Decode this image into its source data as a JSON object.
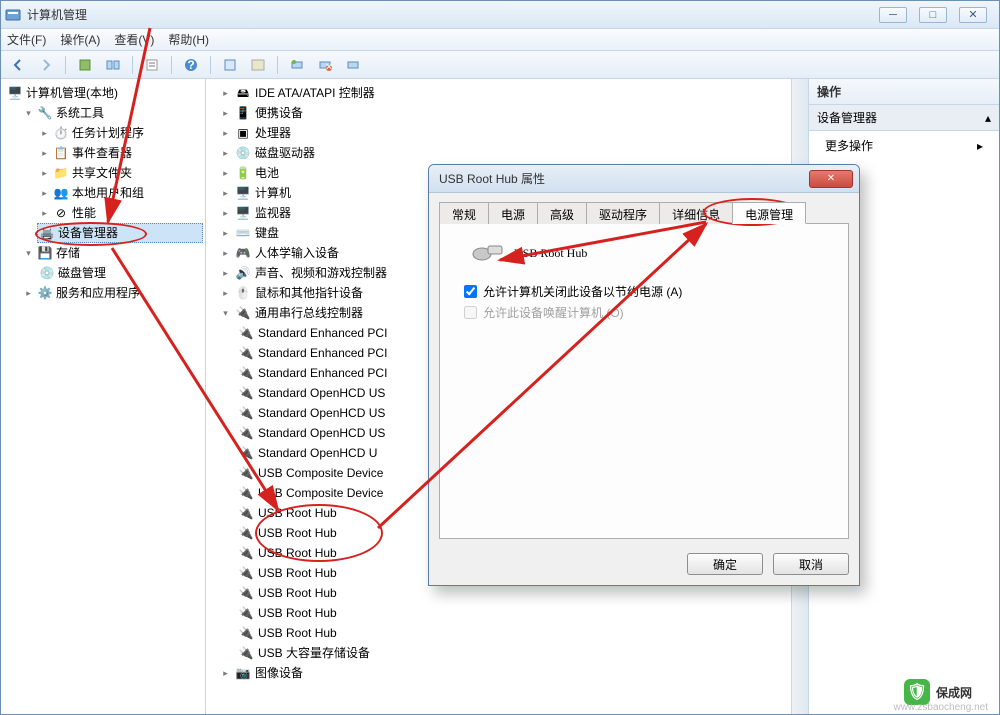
{
  "window": {
    "title": "计算机管理",
    "menus": [
      "文件(F)",
      "操作(A)",
      "查看(V)",
      "帮助(H)"
    ]
  },
  "left_tree": {
    "root": "计算机管理(本地)",
    "system_tools": "系统工具",
    "task_scheduler": "任务计划程序",
    "event_viewer": "事件查看器",
    "shared_folders": "共享文件夹",
    "local_users": "本地用户和组",
    "performance": "性能",
    "device_manager": "设备管理器",
    "storage": "存储",
    "disk_mgmt": "磁盘管理",
    "services": "服务和应用程序"
  },
  "right_panel": {
    "header": "操作",
    "context": "设备管理器",
    "more_actions": "更多操作"
  },
  "devices": {
    "ide": "IDE ATA/ATAPI 控制器",
    "portable": "便携设备",
    "cpu": "处理器",
    "disk_drives": "磁盘驱动器",
    "battery": "电池",
    "computer": "计算机",
    "monitor": "监视器",
    "keyboard": "键盘",
    "hid": "人体学输入设备",
    "sound": "声音、视频和游戏控制器",
    "mouse": "鼠标和其他指针设备",
    "usb_ctrl": "通用串行总线控制器",
    "usb_children": [
      "Standard Enhanced PCI",
      "Standard Enhanced PCI",
      "Standard Enhanced PCI",
      "Standard OpenHCD US",
      "Standard OpenHCD US",
      "Standard OpenHCD US",
      "Standard OpenHCD U",
      "USB Composite Device",
      "USB Composite Device",
      "USB Root Hub",
      "USB Root Hub",
      "USB Root Hub",
      "USB Root Hub",
      "USB Root Hub",
      "USB Root Hub",
      "USB Root Hub",
      "USB 大容量存储设备"
    ],
    "imaging": "图像设备"
  },
  "dialog": {
    "title": "USB Root Hub 属性",
    "tabs": [
      "常规",
      "电源",
      "高级",
      "驱动程序",
      "详细信息",
      "电源管理"
    ],
    "active_tab": "电源管理",
    "device_name": "USB Root Hub",
    "opt1": "允许计算机关闭此设备以节约电源 (A)",
    "opt2": "允许此设备唤醒计算机 (O)",
    "ok": "确定",
    "cancel": "取消"
  },
  "watermark": {
    "text": "保成网",
    "url": "www.zsbaocheng.net"
  }
}
